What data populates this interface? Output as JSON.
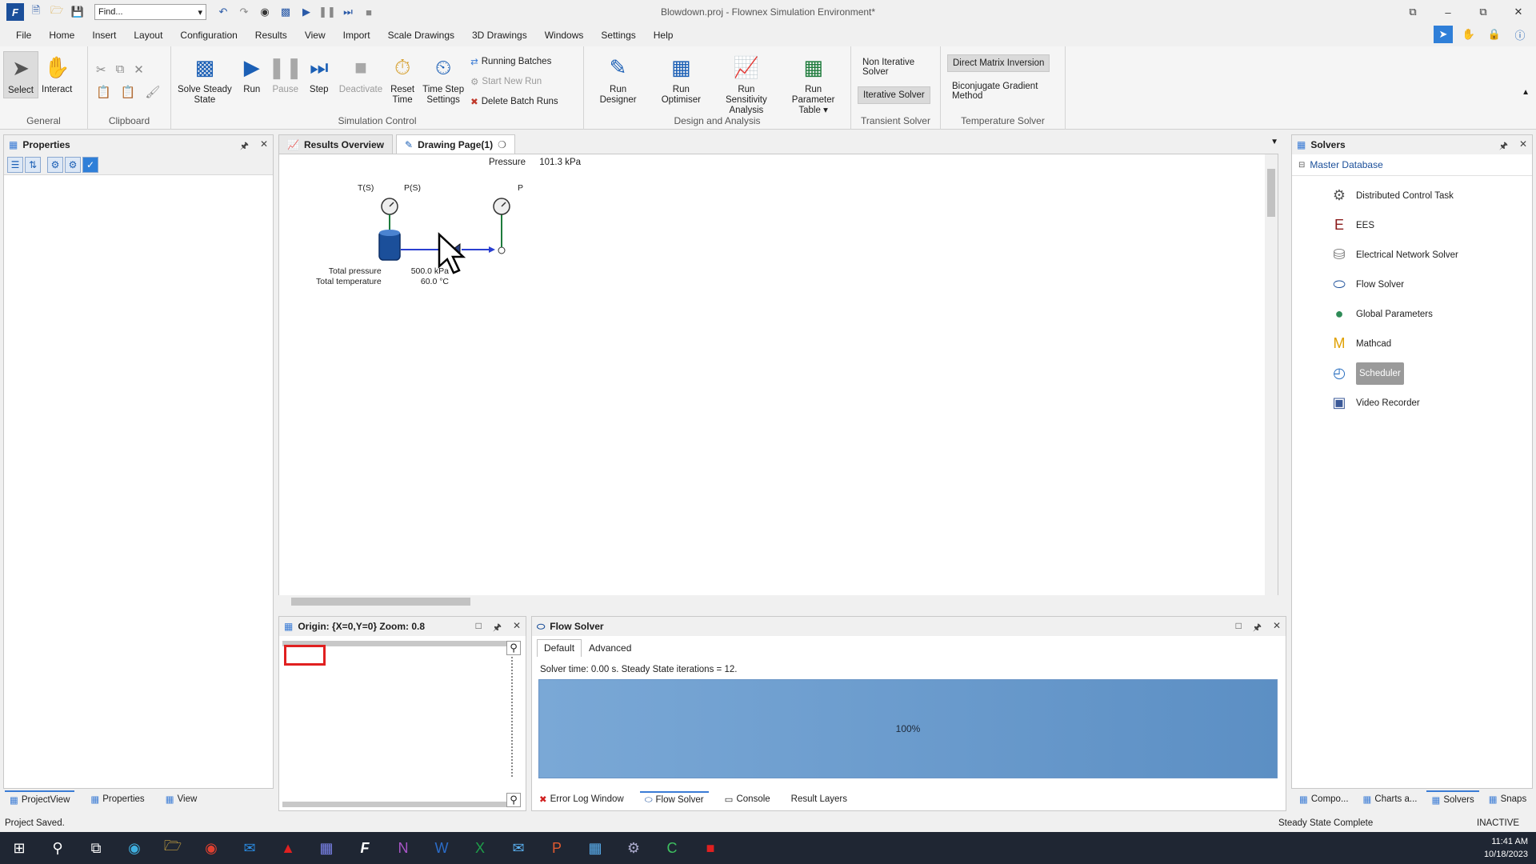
{
  "app": {
    "title": "Blowdown.proj - Flownex Simulation Environment*",
    "find_placeholder": "Find...",
    "window_controls": [
      "⧉",
      "–",
      "⧉",
      "✕"
    ]
  },
  "menu": [
    "File",
    "Home",
    "Insert",
    "Layout",
    "Configuration",
    "Results",
    "View",
    "Import",
    "Scale Drawings",
    "3D Drawings",
    "Windows",
    "Settings",
    "Help"
  ],
  "ribbon": {
    "general": {
      "label": "General",
      "select": "Select",
      "interact": "Interact"
    },
    "clipboard": {
      "label": "Clipboard"
    },
    "simulation": {
      "label": "Simulation Control",
      "solve_steady_1": "Solve Steady",
      "solve_steady_2": "State",
      "run": "Run",
      "pause": "Pause",
      "step": "Step",
      "deactivate": "Deactivate",
      "reset_1": "Reset",
      "reset_2": "Time",
      "timestep_1": "Time Step",
      "timestep_2": "Settings",
      "running_batches": "Running Batches",
      "start_new_run": "Start New Run",
      "delete_batch_runs": "Delete Batch Runs"
    },
    "design": {
      "label": "Design and Analysis",
      "run_designer": "Run Designer",
      "run_optimiser": "Run Optimiser",
      "sens_1": "Run Sensitivity",
      "sens_2": "Analysis",
      "param_1": "Run Parameter",
      "param_2": "Table ▾"
    },
    "transient": {
      "label": "Transient Solver",
      "non_iterative": "Non Iterative Solver",
      "iterative": "Iterative Solver"
    },
    "temperature": {
      "label": "Temperature Solver",
      "direct": "Direct Matrix Inversion",
      "biconjugate": "Biconjugate Gradient Method"
    }
  },
  "properties": {
    "title": "Properties"
  },
  "doc_tabs": {
    "results": "Results Overview",
    "drawing": "Drawing Page(1)"
  },
  "drawing": {
    "pressure_label": "Pressure",
    "pressure_value": "101.3 kPa",
    "ts": "T(S)",
    "ps": "P(S)",
    "p": "P",
    "total_pressure": "Total pressure",
    "total_temperature": "Total temperature",
    "pressure_reading": "500.0 kPa",
    "temperature_reading": "60.0 °C"
  },
  "overview": {
    "title": "Origin: {X=0,Y=0} Zoom: 0.8"
  },
  "flow_solver": {
    "title": "Flow Solver",
    "tab_default": "Default",
    "tab_advanced": "Advanced",
    "solver_time": "Solver time: 0.00 s. Steady State iterations = 12.",
    "progress_label": "100%",
    "progress": 1.0
  },
  "solvers": {
    "title": "Solvers",
    "root": "Master Database",
    "items": [
      {
        "label": "Distributed Control Task",
        "icon": "⚙",
        "color": "#555555"
      },
      {
        "label": "EES",
        "icon": "E",
        "color": "#8b1a1a"
      },
      {
        "label": "Electrical Network Solver",
        "icon": "⛁",
        "color": "#777777"
      },
      {
        "label": "Flow Solver",
        "icon": "⬭",
        "color": "#1b4f9a"
      },
      {
        "label": "Global Parameters",
        "icon": "●",
        "color": "#2e8b57"
      },
      {
        "label": "Mathcad",
        "icon": "M",
        "color": "#e0a000"
      },
      {
        "label": "Scheduler",
        "icon": "◴",
        "color": "#2a6fc0"
      },
      {
        "label": "Video Recorder",
        "icon": "▣",
        "color": "#3b5998"
      }
    ]
  },
  "bottom_left_tabs": [
    "ProjectView",
    "Properties",
    "View"
  ],
  "bottom_center_tabs": [
    "Error Log Window",
    "Flow Solver",
    "Console",
    "Result Layers"
  ],
  "bottom_right_tabs": [
    "Compo...",
    "Charts a...",
    "Solvers",
    "Snaps"
  ],
  "status": {
    "left": "Project Saved.",
    "middle": "Steady State Complete",
    "right": "INACTIVE"
  },
  "clock": {
    "time": "11:41 AM",
    "date": "10/18/2023"
  }
}
